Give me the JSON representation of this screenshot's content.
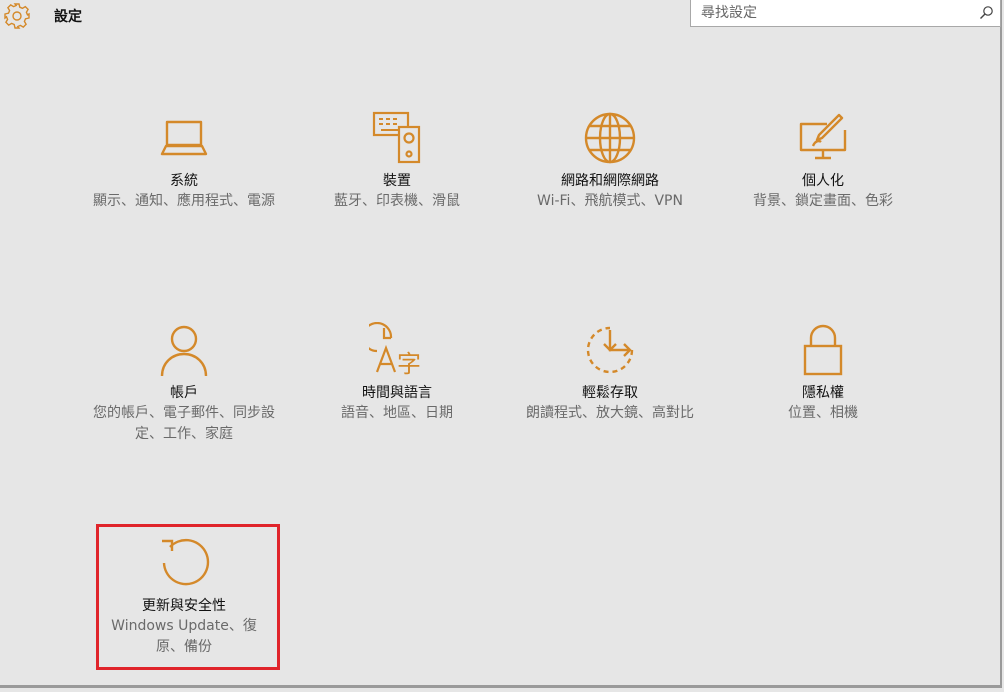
{
  "app": {
    "title": "設定"
  },
  "search": {
    "placeholder": "尋找設定"
  },
  "accent": "#d4892a",
  "highlight_color": "#e0242b",
  "tiles": [
    {
      "id": "system",
      "icon": "laptop-icon",
      "title": "系統",
      "desc": "顯示、通知、應用程式、電源"
    },
    {
      "id": "devices",
      "icon": "devices-icon",
      "title": "裝置",
      "desc": "藍牙、印表機、滑鼠"
    },
    {
      "id": "network",
      "icon": "globe-icon",
      "title": "網路和網際網路",
      "desc": "Wi-Fi、飛航模式、VPN"
    },
    {
      "id": "personalization",
      "icon": "paint-icon",
      "title": "個人化",
      "desc": "背景、鎖定畫面、色彩"
    },
    {
      "id": "accounts",
      "icon": "person-icon",
      "title": "帳戶",
      "desc": "您的帳戶、電子郵件、同步設定、工作、家庭"
    },
    {
      "id": "time-language",
      "icon": "time-language-icon",
      "title": "時間與語言",
      "desc": "語音、地區、日期"
    },
    {
      "id": "ease-of-access",
      "icon": "ease-of-access-icon",
      "title": "輕鬆存取",
      "desc": "朗讀程式、放大鏡、高對比"
    },
    {
      "id": "privacy",
      "icon": "lock-icon",
      "title": "隱私權",
      "desc": "位置、相機"
    },
    {
      "id": "update-security",
      "icon": "refresh-icon",
      "title": "更新與安全性",
      "desc": "Windows Update、復原、備份"
    }
  ]
}
